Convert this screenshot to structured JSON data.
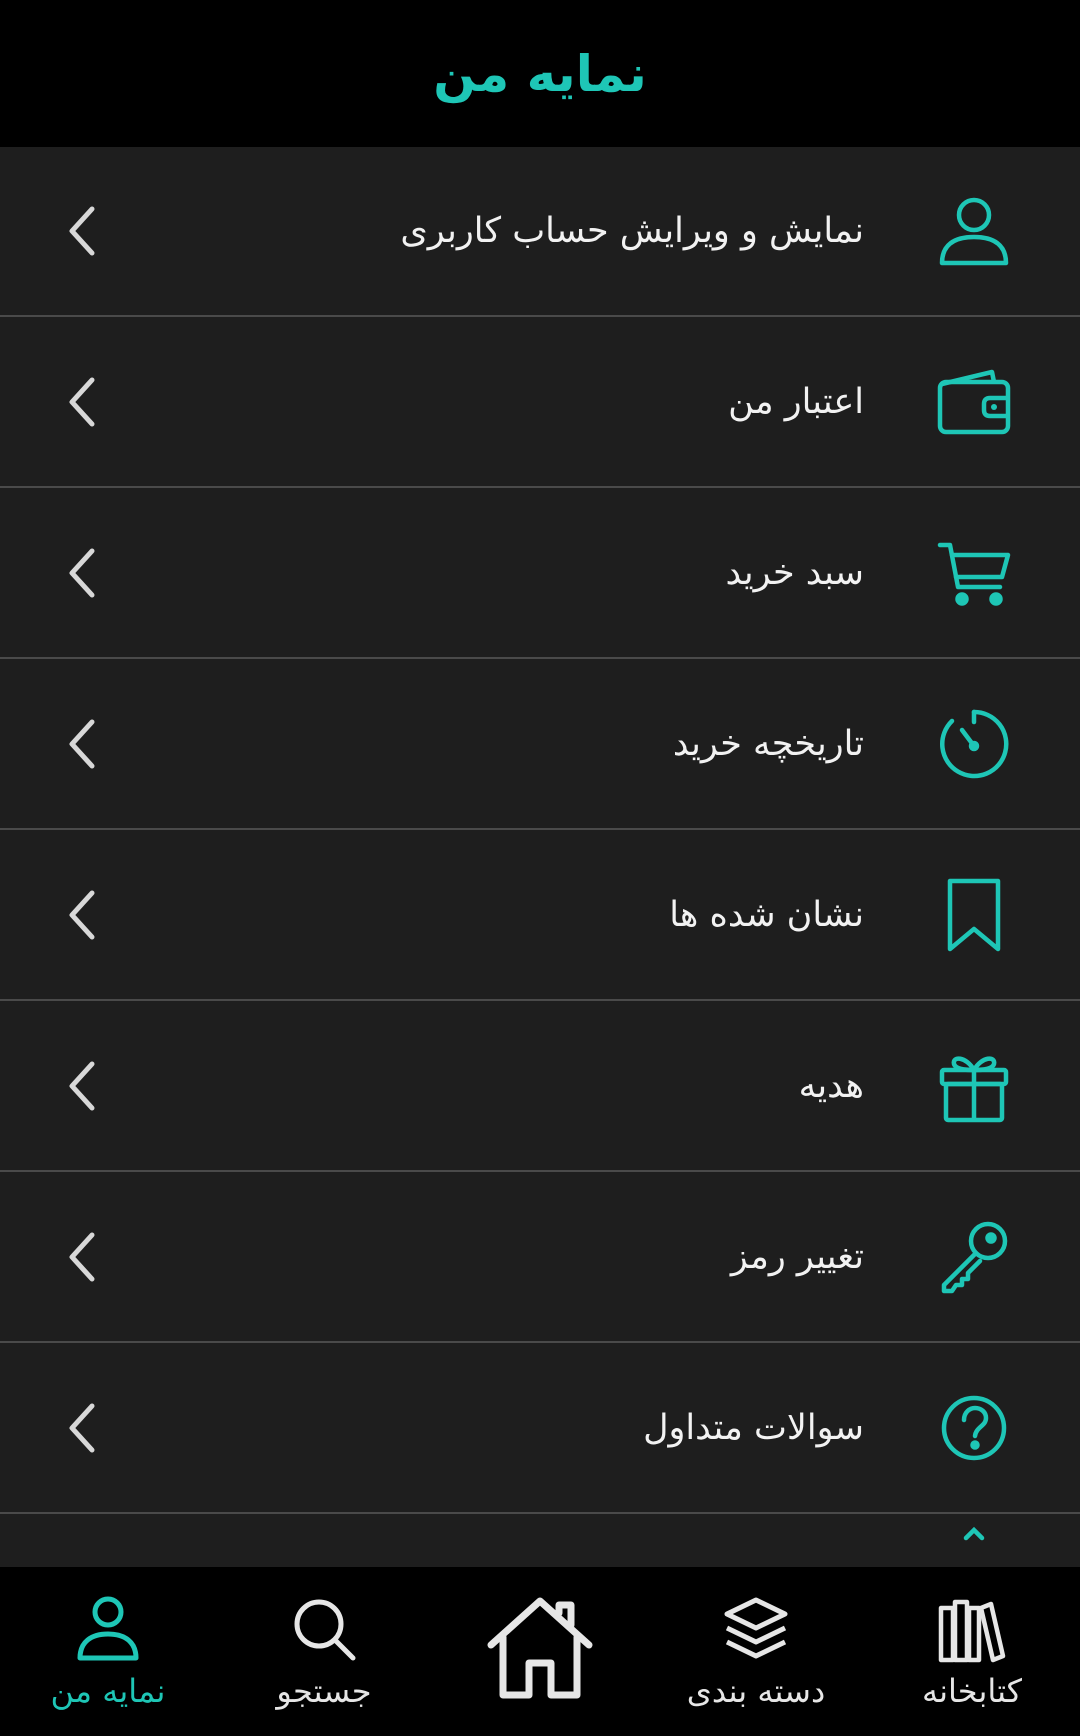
{
  "header": {
    "title": "نمایه من"
  },
  "menu": {
    "items": [
      {
        "label": "نمایش و ویرایش حساب کاربری",
        "icon": "user-icon"
      },
      {
        "label": "اعتبار من",
        "icon": "wallet-icon"
      },
      {
        "label": "سبد خرید",
        "icon": "cart-icon"
      },
      {
        "label": "تاریخچه خرید",
        "icon": "timer-icon"
      },
      {
        "label": "نشان شده ها",
        "icon": "bookmark-icon"
      },
      {
        "label": "هدیه",
        "icon": "gift-icon"
      },
      {
        "label": "تغییر رمز",
        "icon": "key-icon"
      },
      {
        "label": "سوالات متداول",
        "icon": "question-icon"
      }
    ]
  },
  "bottom_nav": {
    "tabs": [
      {
        "label": "نمایه من",
        "icon": "user-icon",
        "active": true
      },
      {
        "label": "جستجو",
        "icon": "search-icon"
      },
      {
        "label": "",
        "icon": "home-icon"
      },
      {
        "label": "دسته بندی",
        "icon": "layers-icon"
      },
      {
        "label": "کتابخانه",
        "icon": "library-icon"
      }
    ]
  },
  "colors": {
    "accent": "#1ec6b6",
    "background": "#1e1e1e",
    "bar": "#000000",
    "text": "#f2f2f2",
    "divider": "#4a4a4a"
  }
}
